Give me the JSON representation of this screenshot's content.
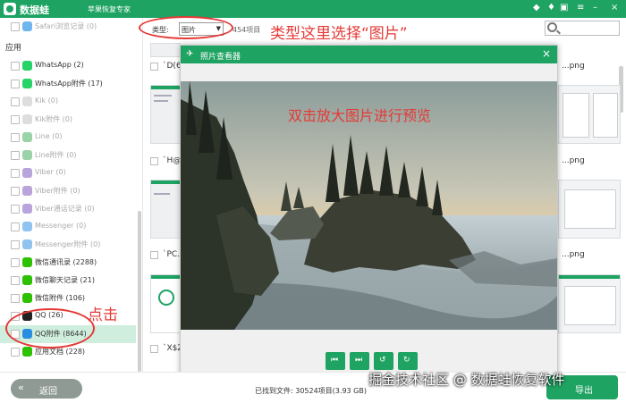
{
  "titlebar": {
    "app_name": "数据蛙",
    "subtitle": "苹果恢复专家",
    "controls": [
      "diamond-icon",
      "shirt-icon",
      "gift-icon",
      "menu-icon",
      "minimize-icon",
      "close-icon"
    ]
  },
  "sidebar": {
    "top_item": "Safari浏览记录 (0)",
    "section_title": "应用",
    "items": [
      {
        "label": "WhatsApp (2)",
        "icon": "whatsapp-icon",
        "color": "#25d366",
        "dim": false
      },
      {
        "label": "WhatsApp附件 (17)",
        "icon": "whatsapp-icon",
        "color": "#25d366",
        "dim": false
      },
      {
        "label": "Kik (0)",
        "icon": "kik-icon",
        "color": "#dddddd",
        "dim": true
      },
      {
        "label": "Kik附件 (0)",
        "icon": "kik-icon",
        "color": "#dddddd",
        "dim": true
      },
      {
        "label": "Line (0)",
        "icon": "line-icon",
        "color": "#9ad3a6",
        "dim": true
      },
      {
        "label": "Line附件 (0)",
        "icon": "line-icon",
        "color": "#9ad3a6",
        "dim": true
      },
      {
        "label": "Viber (0)",
        "icon": "viber-icon",
        "color": "#b9a5dc",
        "dim": true
      },
      {
        "label": "Viber附件 (0)",
        "icon": "viber-icon",
        "color": "#b9a5dc",
        "dim": true
      },
      {
        "label": "Viber通话记录 (0)",
        "icon": "viber-icon",
        "color": "#b9a5dc",
        "dim": true
      },
      {
        "label": "Messenger (0)",
        "icon": "messenger-icon",
        "color": "#8fc3f0",
        "dim": true
      },
      {
        "label": "Messenger附件 (0)",
        "icon": "messenger-icon",
        "color": "#8fc3f0",
        "dim": true
      },
      {
        "label": "微信通讯录 (2288)",
        "icon": "wechat-icon",
        "color": "#2dc100",
        "dim": false
      },
      {
        "label": "微信聊天记录 (21)",
        "icon": "wechat-icon",
        "color": "#2dc100",
        "dim": false
      },
      {
        "label": "微信附件 (106)",
        "icon": "wechat-icon",
        "color": "#2dc100",
        "dim": false
      },
      {
        "label": "QQ (26)",
        "icon": "qq-icon",
        "color": "#222222",
        "dim": false
      },
      {
        "label": "QQ附件 (8644)",
        "icon": "qq-icon",
        "color": "#2a8ee0",
        "dim": false,
        "selected": true
      },
      {
        "label": "应用文档 (228)",
        "icon": "document-icon",
        "color": "#2dc100",
        "dim": false
      }
    ]
  },
  "toolbar": {
    "type_label": "类型:",
    "type_value": "图片",
    "count_text": "454项目"
  },
  "files": {
    "names": [
      "`D(6...",
      "`H@...",
      "`PC...",
      "`X$Z..."
    ],
    "right_names": [
      "...png",
      "...png",
      "...png"
    ]
  },
  "viewer": {
    "title": "照片查看器",
    "nav_buttons": [
      "first-icon",
      "last-icon",
      "rotate-left-icon",
      "rotate-right-icon"
    ]
  },
  "bottom": {
    "back_label": "返回",
    "found_text": "已找到文件: 30524项目(3.93 GB)",
    "export_label": "导出"
  },
  "annotations": {
    "type_hint": "类型这里选择“图片”",
    "preview_hint": "双击放大图片进行预览",
    "click_hint": "点击",
    "accent": "#e53935"
  },
  "watermark": "掘金技术社区 @ 数据蛙恢复软件",
  "colors": {
    "brand": "#1ea362",
    "selected_row": "#cfeedd"
  }
}
